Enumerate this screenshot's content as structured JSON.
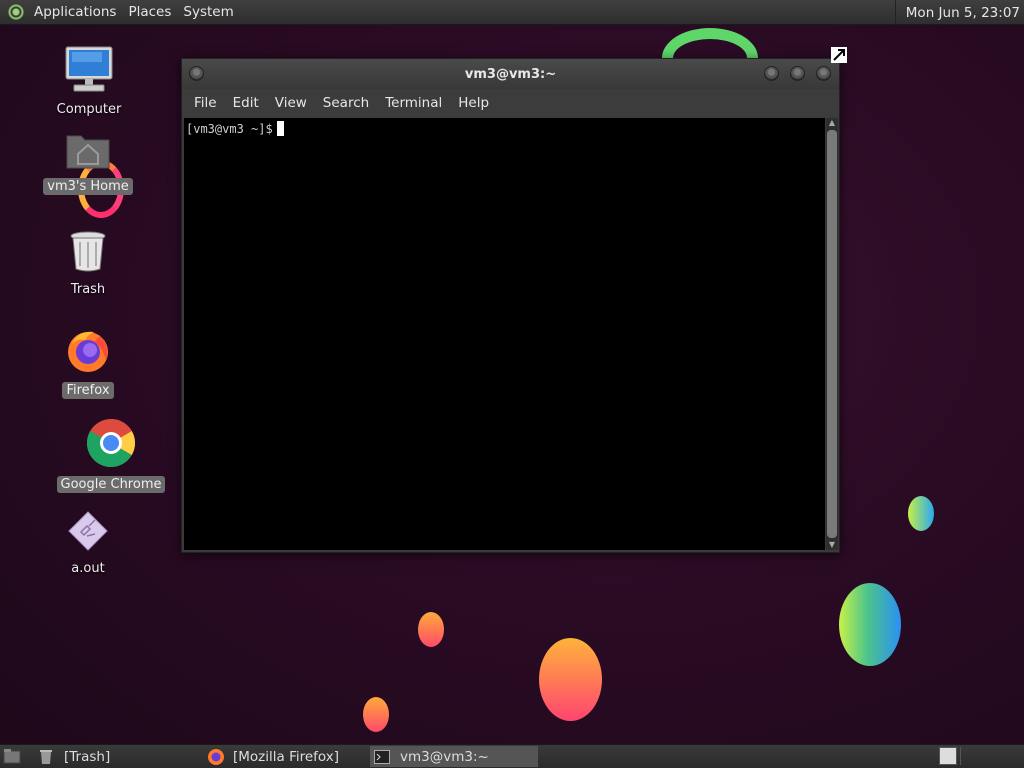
{
  "top_panel": {
    "menus": [
      "Applications",
      "Places",
      "System"
    ],
    "clock": "Mon Jun  5, 23:07"
  },
  "desktop": {
    "icons": [
      {
        "label": "Computer",
        "icon": "computer-icon"
      },
      {
        "label": "vm3's Home",
        "icon": "home-folder-icon"
      },
      {
        "label": "Trash",
        "icon": "trash-icon"
      },
      {
        "label": "Firefox",
        "icon": "firefox-icon"
      },
      {
        "label": "Google Chrome",
        "icon": "chrome-icon"
      },
      {
        "label": "a.out",
        "icon": "executable-icon"
      }
    ]
  },
  "terminal": {
    "title": "vm3@vm3:~",
    "menus": [
      "File",
      "Edit",
      "View",
      "Search",
      "Terminal",
      "Help"
    ],
    "prompt": "[vm3@vm3 ~]$"
  },
  "taskbar": {
    "items": [
      {
        "label": "[Trash]",
        "icon": "trash-icon"
      },
      {
        "label": "[Mozilla Firefox]",
        "icon": "firefox-icon"
      },
      {
        "label": "vm3@vm3:~",
        "icon": "terminal-icon"
      }
    ]
  },
  "colors": {
    "desktop_bg": "#2a0b24",
    "panel_bg": "#333333",
    "terminal_bg": "#000000"
  }
}
